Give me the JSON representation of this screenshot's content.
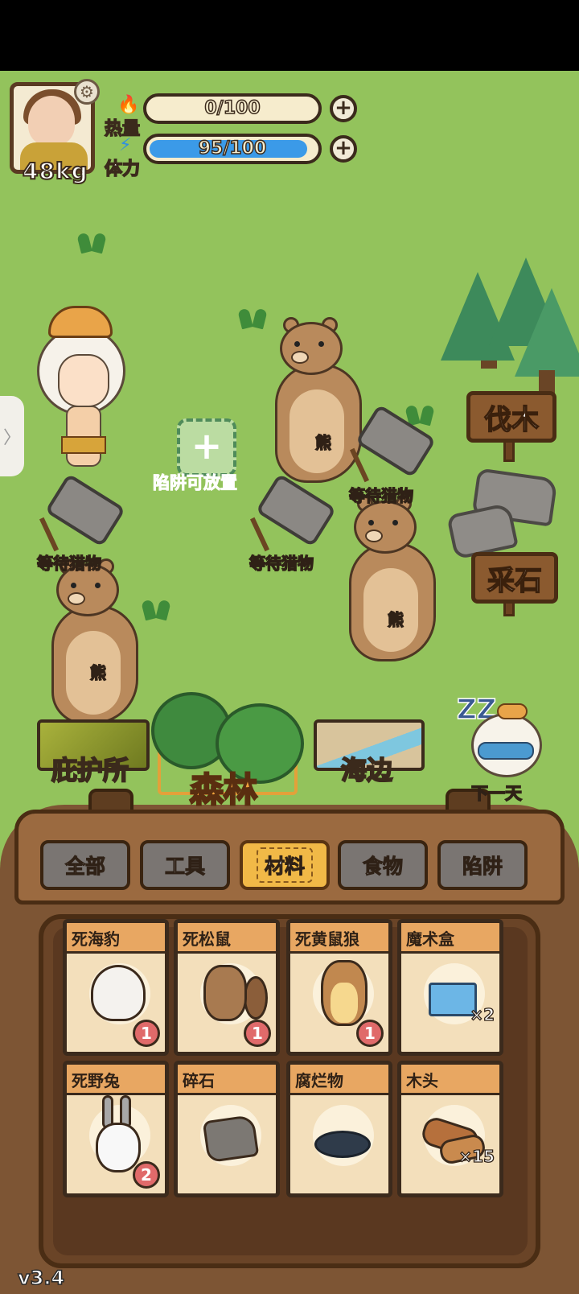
{
  "hud": {
    "weight": "48kg",
    "heat_label": "热量",
    "heat_value": "0/100",
    "heat_fraction": 0,
    "stamina_label": "体力",
    "stamina_value": "95/100",
    "stamina_fraction": 0.95,
    "icons": {
      "settings": "gear-icon",
      "add": "plus-icon",
      "heat": "flame-icon",
      "stamina": "lightning-icon"
    }
  },
  "map": {
    "actions": {
      "chop_wood": "伐木",
      "mine_stone": "采石"
    },
    "trap_slot_label": "陷阱可放置",
    "waiting_label": "等待猎物",
    "bear_name": "熊"
  },
  "locations": {
    "shelter": "庇护所",
    "forest": "森林",
    "seaside": "海边",
    "next_day": "下一天",
    "active": "森林"
  },
  "inventory": {
    "tabs": [
      "全部",
      "工具",
      "材料",
      "食物",
      "陷阱"
    ],
    "active_tab": "材料",
    "items": [
      {
        "name": "死海豹",
        "icon": "seal-icon",
        "badge": "1"
      },
      {
        "name": "死松鼠",
        "icon": "squirrel-icon",
        "badge": "1"
      },
      {
        "name": "死黄鼠狼",
        "icon": "weasel-icon",
        "badge": "1"
      },
      {
        "name": "魔术盒",
        "icon": "magic-box-icon",
        "qty": "×2"
      },
      {
        "name": "死野兔",
        "icon": "rabbit-icon",
        "badge": "2"
      },
      {
        "name": "碎石",
        "icon": "gravel-icon"
      },
      {
        "name": "腐烂物",
        "icon": "rot-icon"
      },
      {
        "name": "木头",
        "icon": "wood-log-icon",
        "qty": "×15"
      }
    ]
  },
  "version": "v3.4",
  "colors": {
    "grass": "#93c35c",
    "accent": "#f0a33c",
    "stamina_bar": "#3b9ae8",
    "badge": "#e06a6a"
  }
}
